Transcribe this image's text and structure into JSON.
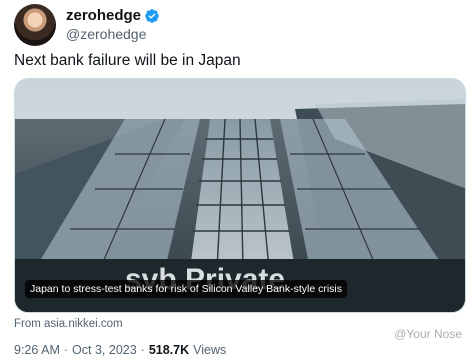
{
  "account": {
    "display_name": "zerohedge",
    "handle": "@zerohedge",
    "verified_color": "#1d9bf0"
  },
  "tweet": {
    "text": "Next bank failure will be in Japan"
  },
  "card": {
    "image_sign_text": "svb Private",
    "caption": "Japan to stress-test banks for risk of Silicon Valley Bank-style crisis",
    "source": "From asia.nikkei.com"
  },
  "meta": {
    "time": "9:26 AM",
    "separator": "·",
    "date": "Oct 3, 2023",
    "views_count": "518.7K",
    "views_label": "Views"
  },
  "watermark": "@Your Nose"
}
